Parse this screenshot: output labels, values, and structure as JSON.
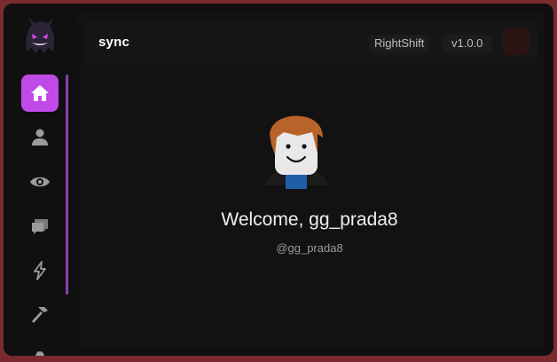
{
  "app": {
    "title": "sync"
  },
  "header": {
    "keybind": "RightShift",
    "version": "v1.0.0"
  },
  "sidebar": {
    "items": [
      {
        "name": "home",
        "icon": "home-icon",
        "active": true
      },
      {
        "name": "player",
        "icon": "user-icon",
        "active": false
      },
      {
        "name": "visuals",
        "icon": "eye-icon",
        "active": false
      },
      {
        "name": "chat",
        "icon": "chat-icon",
        "active": false
      },
      {
        "name": "exploits",
        "icon": "lightning-icon",
        "active": false
      },
      {
        "name": "tools",
        "icon": "hammer-icon",
        "active": false
      }
    ]
  },
  "profile": {
    "welcome": "Welcome, gg_prada8",
    "handle": "@gg_prada8"
  },
  "colors": {
    "accent": "#c04ae8",
    "background": "#0f0f0f",
    "frame": "#7a2a2e"
  }
}
